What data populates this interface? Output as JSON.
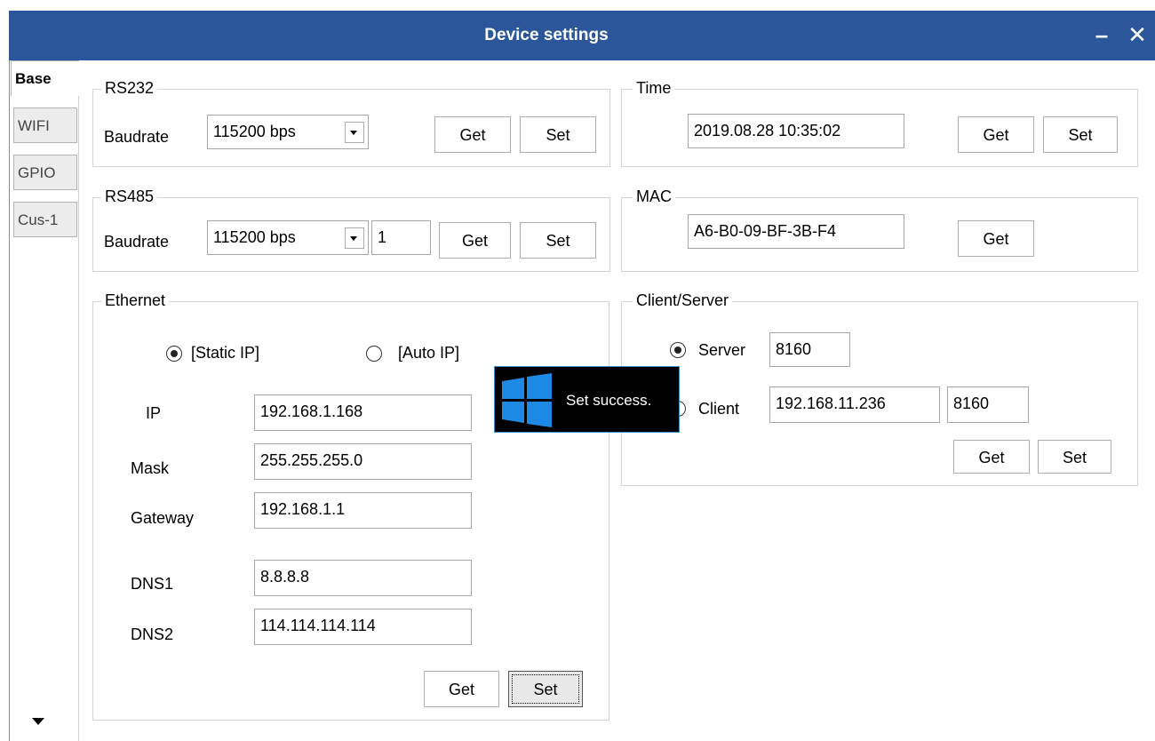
{
  "window": {
    "title": "Device settings",
    "minimize_glyph": "–",
    "close_glyph": "✕"
  },
  "tabs": [
    {
      "label": "Base",
      "active": true
    },
    {
      "label": "WIFI",
      "active": false
    },
    {
      "label": "GPIO",
      "active": false
    },
    {
      "label": "Cus-1",
      "active": false
    }
  ],
  "rs232": {
    "legend": "RS232",
    "baudrate_label": "Baudrate",
    "baudrate_value": "115200 bps",
    "get_label": "Get",
    "set_label": "Set"
  },
  "rs485": {
    "legend": "RS485",
    "baudrate_label": "Baudrate",
    "baudrate_value": "115200 bps",
    "address_value": "1",
    "get_label": "Get",
    "set_label": "Set"
  },
  "time": {
    "legend": "Time",
    "value": "2019.08.28 10:35:02",
    "get_label": "Get",
    "set_label": "Set"
  },
  "mac": {
    "legend": "MAC",
    "value": "A6-B0-09-BF-3B-F4",
    "get_label": "Get"
  },
  "ethernet": {
    "legend": "Ethernet",
    "static_ip_label": "[Static IP]",
    "auto_ip_label": "[Auto IP]",
    "ip_label": "IP",
    "ip_value": "192.168.1.168",
    "mask_label": "Mask",
    "mask_value": "255.255.255.0",
    "gateway_label": "Gateway",
    "gateway_value": "192.168.1.1",
    "dns1_label": "DNS1",
    "dns1_value": "8.8.8.8",
    "dns2_label": "DNS2",
    "dns2_value": "114.114.114.114",
    "get_label": "Get",
    "set_label": "Set"
  },
  "client_server": {
    "legend": "Client/Server",
    "server_label": "Server",
    "server_port": "8160",
    "client_label": "Client",
    "client_ip": "192.168.11.236",
    "client_port": "8160",
    "get_label": "Get",
    "set_label": "Set"
  },
  "toast": {
    "message": "Set success.",
    "accent_color": "#1e88e5"
  },
  "colors": {
    "titlebar": "#2b579a"
  }
}
